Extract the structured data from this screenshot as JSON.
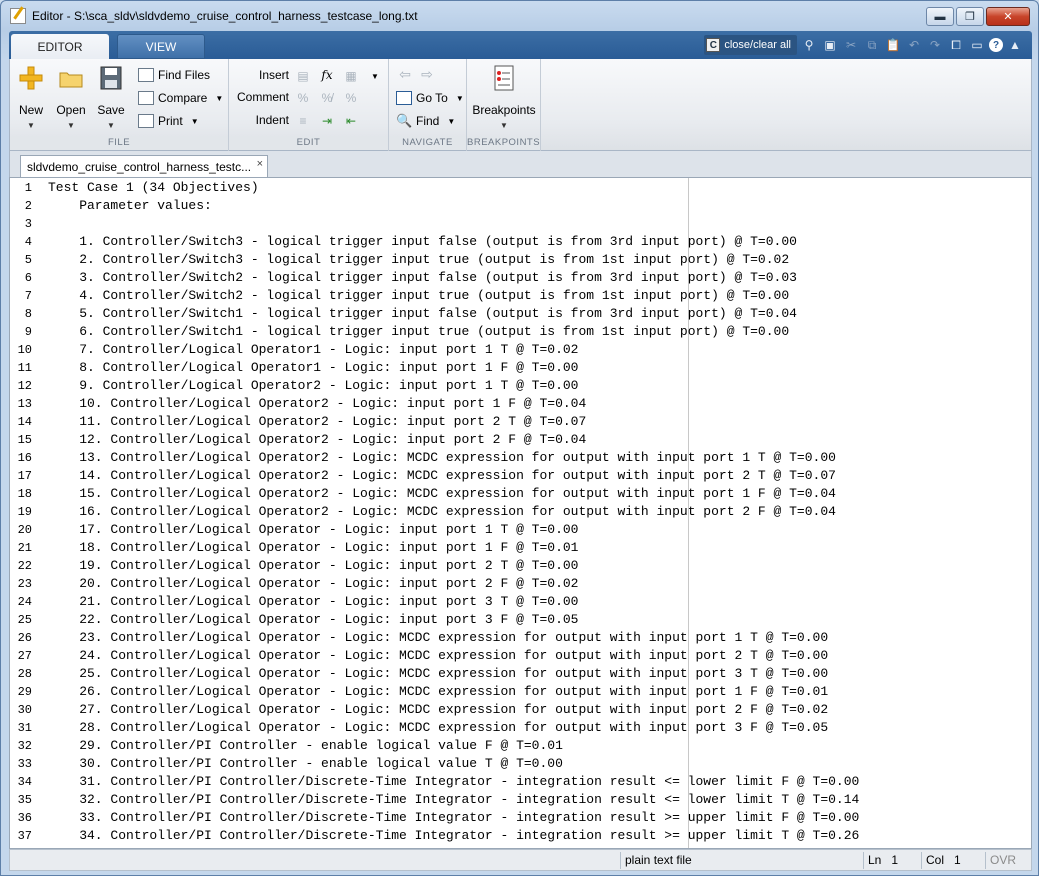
{
  "window": {
    "title": "Editor - S:\\sca_sldv\\sldvdemo_cruise_control_harness_testcase_long.txt",
    "minimize_glyph": "▬",
    "maximize_glyph": "❐",
    "close_glyph": "✕"
  },
  "toolstrip": {
    "tabs": [
      {
        "label": "EDITOR",
        "active": true
      },
      {
        "label": "VIEW",
        "active": false
      }
    ],
    "quick_access": {
      "search_icon": "C",
      "search_text": "close/clear all",
      "help": "?"
    }
  },
  "ribbon": {
    "file": {
      "label": "FILE",
      "new": "New",
      "open": "Open",
      "save": "Save",
      "find_files": "Find Files",
      "compare": "Compare",
      "print": "Print"
    },
    "edit": {
      "label": "EDIT",
      "insert": "Insert",
      "comment": "Comment",
      "indent": "Indent",
      "fx": "fx"
    },
    "navigate": {
      "label": "NAVIGATE",
      "go_to": "Go To",
      "find": "Find"
    },
    "breakpoints": {
      "label": "BREAKPOINTS",
      "breakpoints": "Breakpoints"
    }
  },
  "document_tab": {
    "label": "sldvdemo_cruise_control_harness_testc...",
    "close": "×"
  },
  "editor": {
    "lines": [
      {
        "num": "1",
        "text": "Test Case 1 (34 Objectives)"
      },
      {
        "num": "2",
        "text": "    Parameter values:"
      },
      {
        "num": "3",
        "text": ""
      },
      {
        "num": "4",
        "text": "    1. Controller/Switch3 - logical trigger input false (output is from 3rd input port) @ T=0.00"
      },
      {
        "num": "5",
        "text": "    2. Controller/Switch3 - logical trigger input true (output is from 1st input port) @ T=0.02"
      },
      {
        "num": "6",
        "text": "    3. Controller/Switch2 - logical trigger input false (output is from 3rd input port) @ T=0.03"
      },
      {
        "num": "7",
        "text": "    4. Controller/Switch2 - logical trigger input true (output is from 1st input port) @ T=0.00"
      },
      {
        "num": "8",
        "text": "    5. Controller/Switch1 - logical trigger input false (output is from 3rd input port) @ T=0.04"
      },
      {
        "num": "9",
        "text": "    6. Controller/Switch1 - logical trigger input true (output is from 1st input port) @ T=0.00"
      },
      {
        "num": "10",
        "text": "    7. Controller/Logical Operator1 - Logic: input port 1 T @ T=0.02"
      },
      {
        "num": "11",
        "text": "    8. Controller/Logical Operator1 - Logic: input port 1 F @ T=0.00"
      },
      {
        "num": "12",
        "text": "    9. Controller/Logical Operator2 - Logic: input port 1 T @ T=0.00"
      },
      {
        "num": "13",
        "text": "    10. Controller/Logical Operator2 - Logic: input port 1 F @ T=0.04"
      },
      {
        "num": "14",
        "text": "    11. Controller/Logical Operator2 - Logic: input port 2 T @ T=0.07"
      },
      {
        "num": "15",
        "text": "    12. Controller/Logical Operator2 - Logic: input port 2 F @ T=0.04"
      },
      {
        "num": "16",
        "text": "    13. Controller/Logical Operator2 - Logic: MCDC expression for output with input port 1 T @ T=0.00"
      },
      {
        "num": "17",
        "text": "    14. Controller/Logical Operator2 - Logic: MCDC expression for output with input port 2 T @ T=0.07"
      },
      {
        "num": "18",
        "text": "    15. Controller/Logical Operator2 - Logic: MCDC expression for output with input port 1 F @ T=0.04"
      },
      {
        "num": "19",
        "text": "    16. Controller/Logical Operator2 - Logic: MCDC expression for output with input port 2 F @ T=0.04"
      },
      {
        "num": "20",
        "text": "    17. Controller/Logical Operator - Logic: input port 1 T @ T=0.00"
      },
      {
        "num": "21",
        "text": "    18. Controller/Logical Operator - Logic: input port 1 F @ T=0.01"
      },
      {
        "num": "22",
        "text": "    19. Controller/Logical Operator - Logic: input port 2 T @ T=0.00"
      },
      {
        "num": "23",
        "text": "    20. Controller/Logical Operator - Logic: input port 2 F @ T=0.02"
      },
      {
        "num": "24",
        "text": "    21. Controller/Logical Operator - Logic: input port 3 T @ T=0.00"
      },
      {
        "num": "25",
        "text": "    22. Controller/Logical Operator - Logic: input port 3 F @ T=0.05"
      },
      {
        "num": "26",
        "text": "    23. Controller/Logical Operator - Logic: MCDC expression for output with input port 1 T @ T=0.00"
      },
      {
        "num": "27",
        "text": "    24. Controller/Logical Operator - Logic: MCDC expression for output with input port 2 T @ T=0.00"
      },
      {
        "num": "28",
        "text": "    25. Controller/Logical Operator - Logic: MCDC expression for output with input port 3 T @ T=0.00"
      },
      {
        "num": "29",
        "text": "    26. Controller/Logical Operator - Logic: MCDC expression for output with input port 1 F @ T=0.01"
      },
      {
        "num": "30",
        "text": "    27. Controller/Logical Operator - Logic: MCDC expression for output with input port 2 F @ T=0.02"
      },
      {
        "num": "31",
        "text": "    28. Controller/Logical Operator - Logic: MCDC expression for output with input port 3 F @ T=0.05"
      },
      {
        "num": "32",
        "text": "    29. Controller/PI Controller - enable logical value F @ T=0.01"
      },
      {
        "num": "33",
        "text": "    30. Controller/PI Controller - enable logical value T @ T=0.00"
      },
      {
        "num": "34",
        "text": "    31. Controller/PI Controller/Discrete-Time Integrator - integration result <= lower limit F @ T=0.00"
      },
      {
        "num": "35",
        "text": "    32. Controller/PI Controller/Discrete-Time Integrator - integration result <= lower limit T @ T=0.14"
      },
      {
        "num": "36",
        "text": "    33. Controller/PI Controller/Discrete-Time Integrator - integration result >= upper limit F @ T=0.00"
      },
      {
        "num": "37",
        "text": "    34. Controller/PI Controller/Discrete-Time Integrator - integration result >= upper limit T @ T=0.26"
      }
    ]
  },
  "statusbar": {
    "file_type": "plain text file",
    "ln_label": "Ln",
    "ln_value": "1",
    "col_label": "Col",
    "col_value": "1",
    "ovr": "OVR"
  }
}
